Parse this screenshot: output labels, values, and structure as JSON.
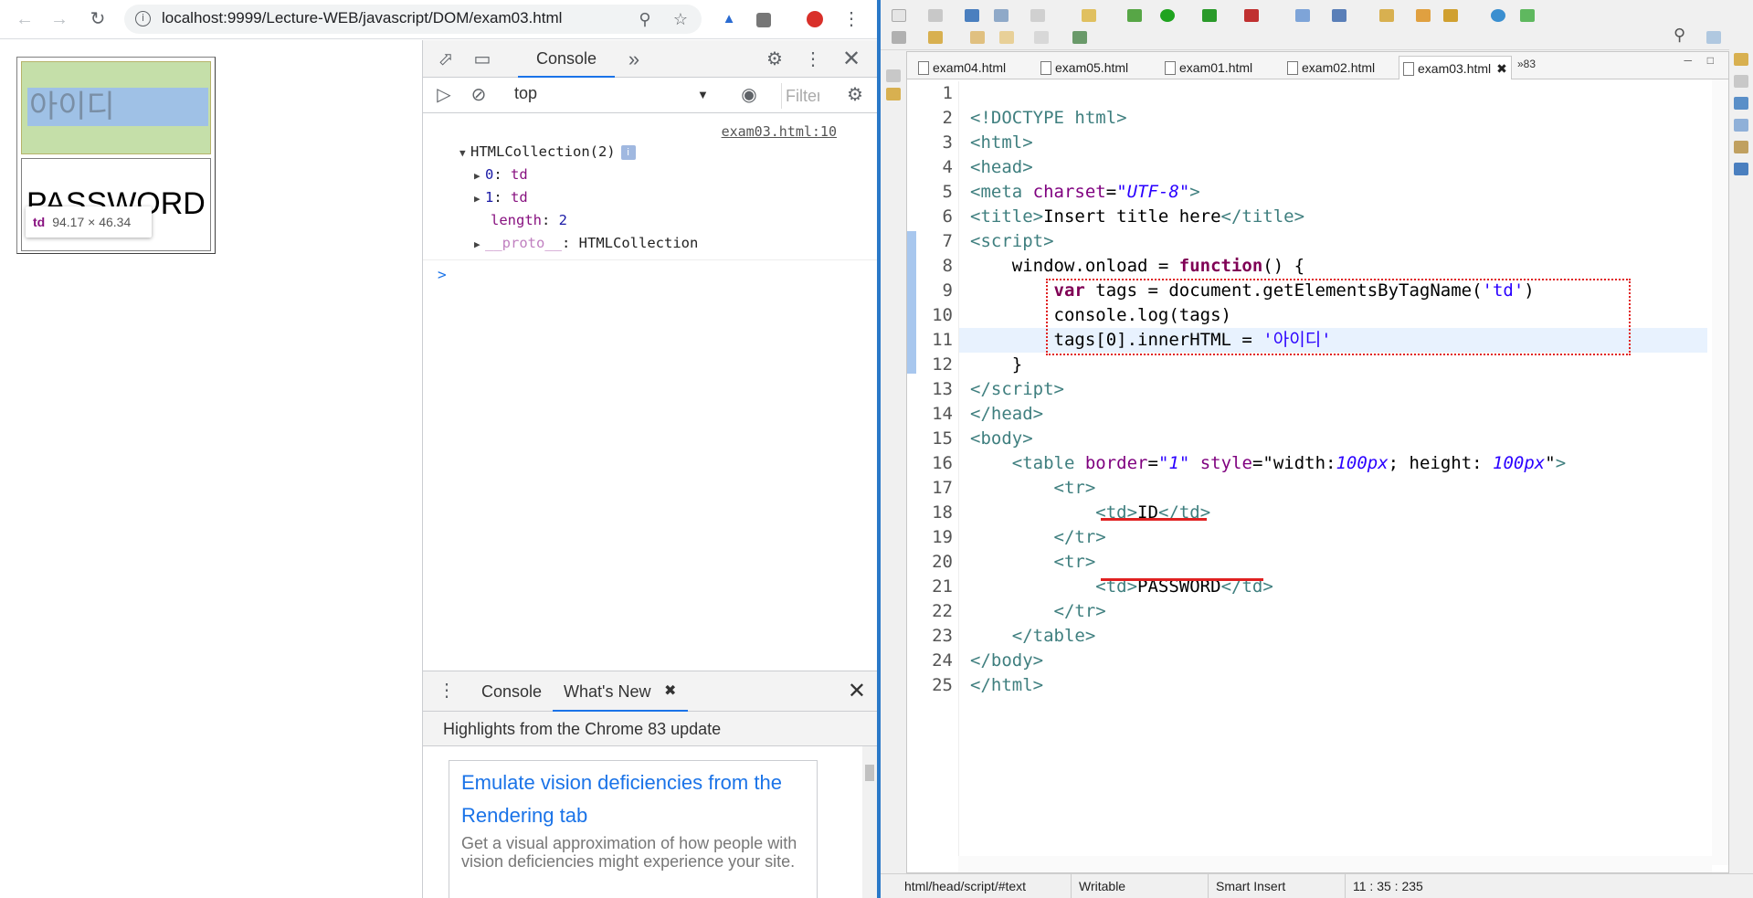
{
  "browser": {
    "url": "localhost:9999/Lecture-WEB/javascript/DOM/exam03.html",
    "nav_icons": [
      "back-icon",
      "forward-icon",
      "reload-icon"
    ],
    "toolbar_icons": [
      "zoom-icon",
      "star-icon",
      "extension-icon",
      "extension-icon",
      "extension-icon",
      "menu-icon"
    ]
  },
  "page": {
    "cell1_text": "아이디",
    "cell2_text": "PASSWORD",
    "tooltip": {
      "tag": "td",
      "size": "94.17 × 46.34"
    }
  },
  "devtools": {
    "main_tab": "Console",
    "context": "top",
    "filter_placeholder": "Filter",
    "source_link": "exam03.html:10",
    "collection_header": "HTMLCollection(2)",
    "info_badge": "i",
    "items": [
      {
        "key": "0",
        "value": "td"
      },
      {
        "key": "1",
        "value": "td"
      }
    ],
    "length_key": "length",
    "length_value": "2",
    "proto_key": "__proto__",
    "proto_value": "HTMLCollection",
    "prompt": ">"
  },
  "drawer": {
    "tabs": [
      "Console",
      "What's New"
    ],
    "highlights": "Highlights from the Chrome 83 update",
    "card_title": "Emulate vision deficiencies from the Rendering tab",
    "card_desc": "Get a visual approximation of how people with vision deficiencies might experience your site."
  },
  "eclipse": {
    "tabs": [
      "exam04.html",
      "exam05.html",
      "exam01.html",
      "exam02.html",
      "exam03.html"
    ],
    "active_tab": "exam03.html",
    "more_tabs": "»83",
    "line_numbers": [
      "1",
      "2",
      "3",
      "4",
      "5",
      "6",
      "7",
      "8",
      "9",
      "10",
      "11",
      "12",
      "13",
      "14",
      "15",
      "16",
      "17",
      "18",
      "19",
      "20",
      "21",
      "22",
      "23",
      "24",
      "25"
    ],
    "status": {
      "path": "html/head/script/#text",
      "mode": "Writable",
      "insert": "Smart Insert",
      "position": "11 : 35 : 235"
    },
    "accent_color": "#2b79c8",
    "highlight_color": "#e02020"
  }
}
